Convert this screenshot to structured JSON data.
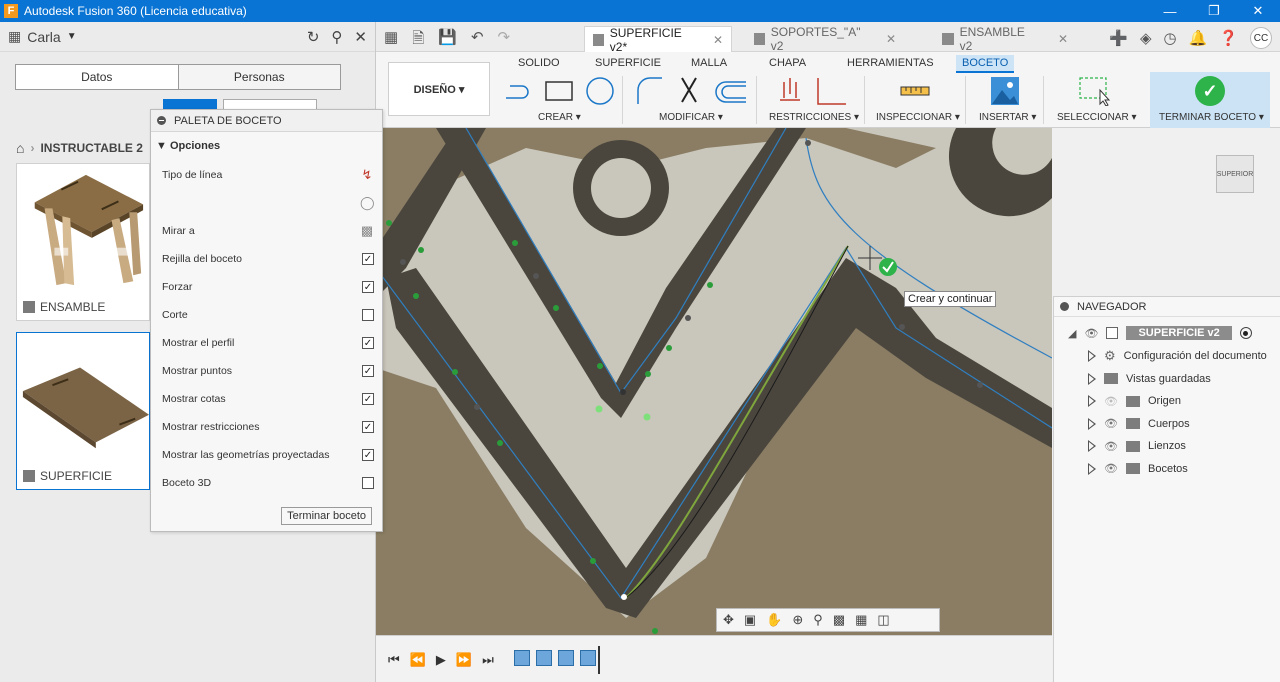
{
  "window": {
    "title": "Autodesk Fusion 360 (Licencia educativa)",
    "app_icon": "F"
  },
  "data_panel": {
    "user": "Carla",
    "tabs": [
      "Datos",
      "Personas"
    ],
    "breadcrumb": "INSTRUCTABLE 2",
    "cards": [
      {
        "label": "ENSAMBLE"
      },
      {
        "label": "SUPERFICIE"
      }
    ]
  },
  "doc_tabs": [
    {
      "label": "SUPERFICIE v2*",
      "active": true
    },
    {
      "label": "SOPORTES_\"A\" v2",
      "active": false
    },
    {
      "label": "ENSAMBLE v2",
      "active": false
    }
  ],
  "ribbon": {
    "workspace": "DISEÑO ▾",
    "tabs": [
      "SOLIDO",
      "SUPERFICIE",
      "MALLA",
      "CHAPA",
      "HERRAMIENTAS",
      "BOCETO"
    ],
    "active_tab": "BOCETO",
    "groups": [
      "CREAR ▾",
      "MODIFICAR ▾",
      "RESTRICCIONES ▾",
      "INSPECCIONAR ▾",
      "INSERTAR ▾",
      "SELECCIONAR ▾",
      "TERMINAR BOCETO ▾"
    ]
  },
  "palette": {
    "title": "PALETA DE BOCETO",
    "section": "Opciones",
    "rows": [
      {
        "label": "Tipo de línea",
        "kind": "icon"
      },
      {
        "label": "",
        "kind": "icon"
      },
      {
        "label": "Mirar a",
        "kind": "icon"
      },
      {
        "label": "Rejilla del boceto",
        "kind": "check",
        "checked": true
      },
      {
        "label": "Forzar",
        "kind": "check",
        "checked": true
      },
      {
        "label": "Corte",
        "kind": "check",
        "checked": false
      },
      {
        "label": "Mostrar el perfil",
        "kind": "check",
        "checked": true
      },
      {
        "label": "Mostrar puntos",
        "kind": "check",
        "checked": true
      },
      {
        "label": "Mostrar cotas",
        "kind": "check",
        "checked": true
      },
      {
        "label": "Mostrar restricciones",
        "kind": "check",
        "checked": true
      },
      {
        "label": "Mostrar las geometrías proyectadas",
        "kind": "check",
        "checked": true
      },
      {
        "label": "Boceto 3D",
        "kind": "check",
        "checked": false
      }
    ],
    "finish_button": "Terminar boceto"
  },
  "canvas": {
    "tooltip": "Crear y continuar",
    "viewcube": "SUPERIOR"
  },
  "navigator": {
    "title": "NAVEGADOR",
    "root": "SUPERFICIE v2",
    "items": [
      {
        "label": "Configuración del documento"
      },
      {
        "label": "Vistas guardadas"
      },
      {
        "label": "Origen"
      },
      {
        "label": "Cuerpos"
      },
      {
        "label": "Lienzos"
      },
      {
        "label": "Bocetos"
      }
    ]
  },
  "colors": {
    "accent": "#0a74d4",
    "finish_green": "#2db34a"
  }
}
